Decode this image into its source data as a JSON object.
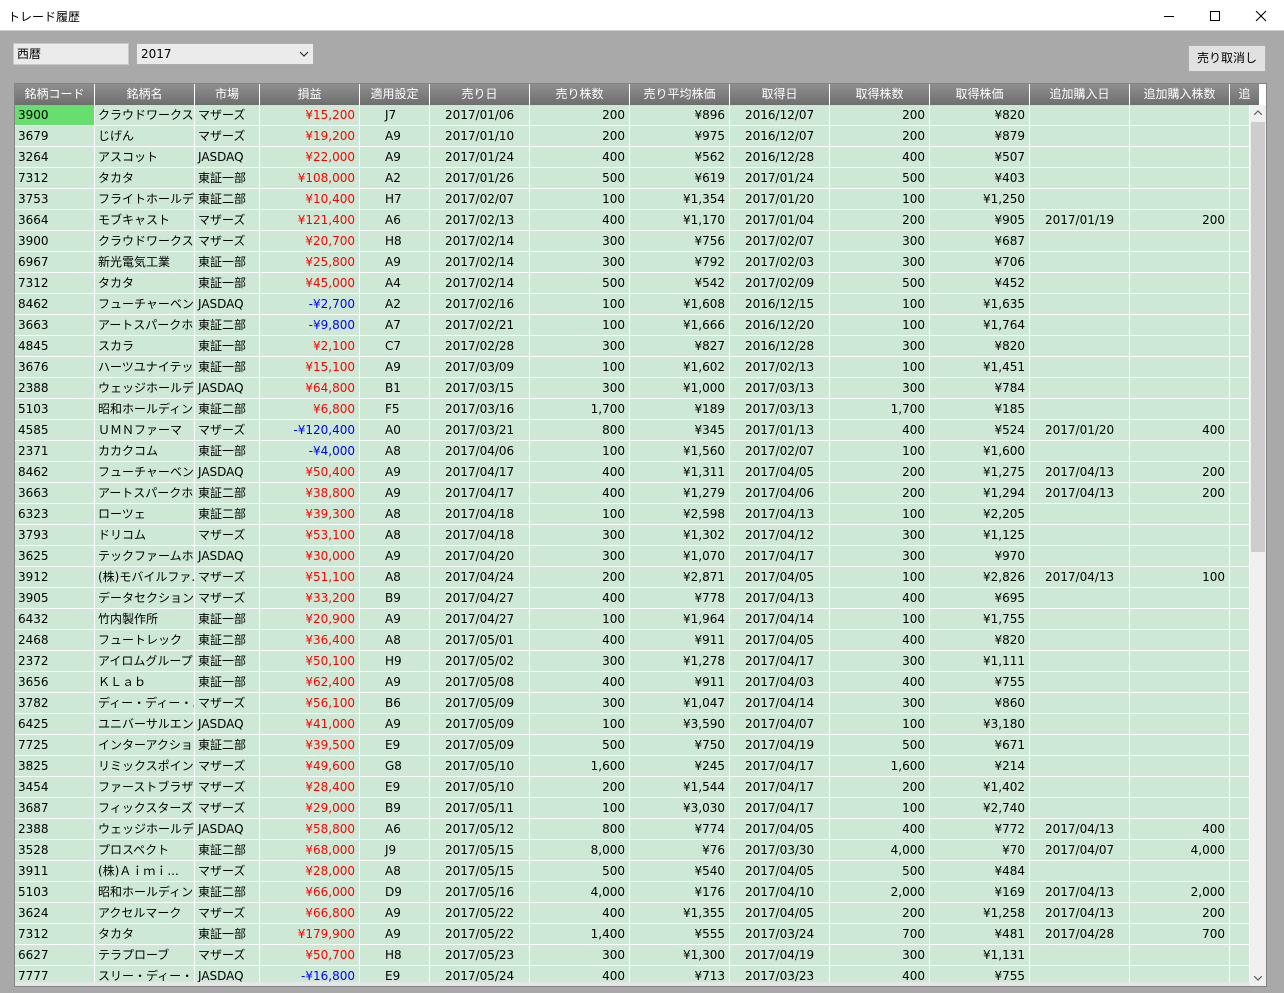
{
  "window": {
    "title": "トレード履歴"
  },
  "toolbar": {
    "era_label": "西暦",
    "year_value": "2017",
    "cancel_sell_label": "売り取消し"
  },
  "columns": [
    "銘柄コード",
    "銘柄名",
    "市場",
    "損益",
    "適用設定",
    "売り日",
    "売り株数",
    "売り平均株価",
    "取得日",
    "取得株数",
    "取得株価",
    "追加購入日",
    "追加購入株数",
    "追"
  ],
  "rows": [
    {
      "code": "3900",
      "name": "クラウドワークス",
      "market": "マザーズ",
      "pl": "¥15,200",
      "setting": "J7",
      "sell_date": "2017/01/06",
      "sell_qty": "200",
      "sell_avg": "¥896",
      "buy_date": "2016/12/07",
      "buy_qty": "200",
      "buy_price": "¥820",
      "add_date": "",
      "add_qty": ""
    },
    {
      "code": "3679",
      "name": "じげん",
      "market": "マザーズ",
      "pl": "¥19,200",
      "setting": "A9",
      "sell_date": "2017/01/10",
      "sell_qty": "200",
      "sell_avg": "¥975",
      "buy_date": "2016/12/07",
      "buy_qty": "200",
      "buy_price": "¥879",
      "add_date": "",
      "add_qty": ""
    },
    {
      "code": "3264",
      "name": "アスコット",
      "market": "JASDAQ",
      "pl": "¥22,000",
      "setting": "A9",
      "sell_date": "2017/01/24",
      "sell_qty": "400",
      "sell_avg": "¥562",
      "buy_date": "2016/12/28",
      "buy_qty": "400",
      "buy_price": "¥507",
      "add_date": "",
      "add_qty": ""
    },
    {
      "code": "7312",
      "name": "タカタ",
      "market": "東証一部",
      "pl": "¥108,000",
      "setting": "A2",
      "sell_date": "2017/01/26",
      "sell_qty": "500",
      "sell_avg": "¥619",
      "buy_date": "2017/01/24",
      "buy_qty": "500",
      "buy_price": "¥403",
      "add_date": "",
      "add_qty": ""
    },
    {
      "code": "3753",
      "name": "フライトホールディ...",
      "market": "東証二部",
      "pl": "¥10,400",
      "setting": "H7",
      "sell_date": "2017/02/07",
      "sell_qty": "100",
      "sell_avg": "¥1,354",
      "buy_date": "2017/01/20",
      "buy_qty": "100",
      "buy_price": "¥1,250",
      "add_date": "",
      "add_qty": ""
    },
    {
      "code": "3664",
      "name": "モブキャスト",
      "market": "マザーズ",
      "pl": "¥121,400",
      "setting": "A6",
      "sell_date": "2017/02/13",
      "sell_qty": "400",
      "sell_avg": "¥1,170",
      "buy_date": "2017/01/04",
      "buy_qty": "200",
      "buy_price": "¥905",
      "add_date": "2017/01/19",
      "add_qty": "200"
    },
    {
      "code": "3900",
      "name": "クラウドワークス",
      "market": "マザーズ",
      "pl": "¥20,700",
      "setting": "H8",
      "sell_date": "2017/02/14",
      "sell_qty": "300",
      "sell_avg": "¥756",
      "buy_date": "2017/02/07",
      "buy_qty": "300",
      "buy_price": "¥687",
      "add_date": "",
      "add_qty": ""
    },
    {
      "code": "6967",
      "name": "新光電気工業",
      "market": "東証一部",
      "pl": "¥25,800",
      "setting": "A9",
      "sell_date": "2017/02/14",
      "sell_qty": "300",
      "sell_avg": "¥792",
      "buy_date": "2017/02/03",
      "buy_qty": "300",
      "buy_price": "¥706",
      "add_date": "",
      "add_qty": ""
    },
    {
      "code": "7312",
      "name": "タカタ",
      "market": "東証一部",
      "pl": "¥45,000",
      "setting": "A4",
      "sell_date": "2017/02/14",
      "sell_qty": "500",
      "sell_avg": "¥542",
      "buy_date": "2017/02/09",
      "buy_qty": "500",
      "buy_price": "¥452",
      "add_date": "",
      "add_qty": ""
    },
    {
      "code": "8462",
      "name": "フューチャーベンチ...",
      "market": "JASDAQ",
      "pl": "-¥2,700",
      "setting": "A2",
      "sell_date": "2017/02/16",
      "sell_qty": "100",
      "sell_avg": "¥1,608",
      "buy_date": "2016/12/15",
      "buy_qty": "100",
      "buy_price": "¥1,635",
      "add_date": "",
      "add_qty": ""
    },
    {
      "code": "3663",
      "name": "アートスパークホ...",
      "market": "東証二部",
      "pl": "-¥9,800",
      "setting": "A7",
      "sell_date": "2017/02/21",
      "sell_qty": "100",
      "sell_avg": "¥1,666",
      "buy_date": "2016/12/20",
      "buy_qty": "100",
      "buy_price": "¥1,764",
      "add_date": "",
      "add_qty": ""
    },
    {
      "code": "4845",
      "name": "スカラ",
      "market": "東証一部",
      "pl": "¥2,100",
      "setting": "C7",
      "sell_date": "2017/02/28",
      "sell_qty": "300",
      "sell_avg": "¥827",
      "buy_date": "2016/12/28",
      "buy_qty": "300",
      "buy_price": "¥820",
      "add_date": "",
      "add_qty": ""
    },
    {
      "code": "3676",
      "name": "ハーツユナイテッ...",
      "market": "東証一部",
      "pl": "¥15,100",
      "setting": "A9",
      "sell_date": "2017/03/09",
      "sell_qty": "100",
      "sell_avg": "¥1,602",
      "buy_date": "2017/02/13",
      "buy_qty": "100",
      "buy_price": "¥1,451",
      "add_date": "",
      "add_qty": ""
    },
    {
      "code": "2388",
      "name": "ウェッジホールディ...",
      "market": "JASDAQ",
      "pl": "¥64,800",
      "setting": "B1",
      "sell_date": "2017/03/15",
      "sell_qty": "300",
      "sell_avg": "¥1,000",
      "buy_date": "2017/03/13",
      "buy_qty": "300",
      "buy_price": "¥784",
      "add_date": "",
      "add_qty": ""
    },
    {
      "code": "5103",
      "name": "昭和ホールディン...",
      "market": "東証二部",
      "pl": "¥6,800",
      "setting": "F5",
      "sell_date": "2017/03/16",
      "sell_qty": "1,700",
      "sell_avg": "¥189",
      "buy_date": "2017/03/13",
      "buy_qty": "1,700",
      "buy_price": "¥185",
      "add_date": "",
      "add_qty": ""
    },
    {
      "code": "4585",
      "name": "ＵＭＮファーマ",
      "market": "マザーズ",
      "pl": "-¥120,400",
      "setting": "A0",
      "sell_date": "2017/03/21",
      "sell_qty": "800",
      "sell_avg": "¥345",
      "buy_date": "2017/01/13",
      "buy_qty": "400",
      "buy_price": "¥524",
      "add_date": "2017/01/20",
      "add_qty": "400"
    },
    {
      "code": "2371",
      "name": "カカクコム",
      "market": "東証一部",
      "pl": "-¥4,000",
      "setting": "A8",
      "sell_date": "2017/04/06",
      "sell_qty": "100",
      "sell_avg": "¥1,560",
      "buy_date": "2017/02/07",
      "buy_qty": "100",
      "buy_price": "¥1,600",
      "add_date": "",
      "add_qty": ""
    },
    {
      "code": "8462",
      "name": "フューチャーベンチ...",
      "market": "JASDAQ",
      "pl": "¥50,400",
      "setting": "A9",
      "sell_date": "2017/04/17",
      "sell_qty": "400",
      "sell_avg": "¥1,311",
      "buy_date": "2017/04/05",
      "buy_qty": "200",
      "buy_price": "¥1,275",
      "add_date": "2017/04/13",
      "add_qty": "200"
    },
    {
      "code": "3663",
      "name": "アートスパークホ...",
      "market": "東証二部",
      "pl": "¥38,800",
      "setting": "A9",
      "sell_date": "2017/04/17",
      "sell_qty": "400",
      "sell_avg": "¥1,279",
      "buy_date": "2017/04/06",
      "buy_qty": "200",
      "buy_price": "¥1,294",
      "add_date": "2017/04/13",
      "add_qty": "200"
    },
    {
      "code": "6323",
      "name": "ローツェ",
      "market": "東証二部",
      "pl": "¥39,300",
      "setting": "A8",
      "sell_date": "2017/04/18",
      "sell_qty": "100",
      "sell_avg": "¥2,598",
      "buy_date": "2017/04/13",
      "buy_qty": "100",
      "buy_price": "¥2,205",
      "add_date": "",
      "add_qty": ""
    },
    {
      "code": "3793",
      "name": "ドリコム",
      "market": "マザーズ",
      "pl": "¥53,100",
      "setting": "A8",
      "sell_date": "2017/04/18",
      "sell_qty": "300",
      "sell_avg": "¥1,302",
      "buy_date": "2017/04/12",
      "buy_qty": "300",
      "buy_price": "¥1,125",
      "add_date": "",
      "add_qty": ""
    },
    {
      "code": "3625",
      "name": "テックファームホー...",
      "market": "JASDAQ",
      "pl": "¥30,000",
      "setting": "A9",
      "sell_date": "2017/04/20",
      "sell_qty": "300",
      "sell_avg": "¥1,070",
      "buy_date": "2017/04/17",
      "buy_qty": "300",
      "buy_price": "¥970",
      "add_date": "",
      "add_qty": ""
    },
    {
      "code": "3912",
      "name": "(株)モバイルファ...",
      "market": "マザーズ",
      "pl": "¥51,100",
      "setting": "A8",
      "sell_date": "2017/04/24",
      "sell_qty": "200",
      "sell_avg": "¥2,871",
      "buy_date": "2017/04/05",
      "buy_qty": "100",
      "buy_price": "¥2,826",
      "add_date": "2017/04/13",
      "add_qty": "100"
    },
    {
      "code": "3905",
      "name": "データセクション",
      "market": "マザーズ",
      "pl": "¥33,200",
      "setting": "B9",
      "sell_date": "2017/04/27",
      "sell_qty": "400",
      "sell_avg": "¥778",
      "buy_date": "2017/04/13",
      "buy_qty": "400",
      "buy_price": "¥695",
      "add_date": "",
      "add_qty": ""
    },
    {
      "code": "6432",
      "name": "竹内製作所",
      "market": "東証一部",
      "pl": "¥20,900",
      "setting": "A9",
      "sell_date": "2017/04/27",
      "sell_qty": "100",
      "sell_avg": "¥1,964",
      "buy_date": "2017/04/14",
      "buy_qty": "100",
      "buy_price": "¥1,755",
      "add_date": "",
      "add_qty": ""
    },
    {
      "code": "2468",
      "name": "フュートレック",
      "market": "東証二部",
      "pl": "¥36,400",
      "setting": "A8",
      "sell_date": "2017/05/01",
      "sell_qty": "400",
      "sell_avg": "¥911",
      "buy_date": "2017/04/05",
      "buy_qty": "400",
      "buy_price": "¥820",
      "add_date": "",
      "add_qty": ""
    },
    {
      "code": "2372",
      "name": "アイロムグループ",
      "market": "東証一部",
      "pl": "¥50,100",
      "setting": "H9",
      "sell_date": "2017/05/02",
      "sell_qty": "300",
      "sell_avg": "¥1,278",
      "buy_date": "2017/04/17",
      "buy_qty": "300",
      "buy_price": "¥1,111",
      "add_date": "",
      "add_qty": ""
    },
    {
      "code": "3656",
      "name": "ＫＬａｂ",
      "market": "東証一部",
      "pl": "¥62,400",
      "setting": "A9",
      "sell_date": "2017/05/08",
      "sell_qty": "400",
      "sell_avg": "¥911",
      "buy_date": "2017/04/03",
      "buy_qty": "400",
      "buy_price": "¥755",
      "add_date": "",
      "add_qty": ""
    },
    {
      "code": "3782",
      "name": "ディー・ディー・エス",
      "market": "マザーズ",
      "pl": "¥56,100",
      "setting": "B6",
      "sell_date": "2017/05/09",
      "sell_qty": "300",
      "sell_avg": "¥1,047",
      "buy_date": "2017/04/14",
      "buy_qty": "300",
      "buy_price": "¥860",
      "add_date": "",
      "add_qty": ""
    },
    {
      "code": "6425",
      "name": "ユニバーサルエン...",
      "market": "JASDAQ",
      "pl": "¥41,000",
      "setting": "A9",
      "sell_date": "2017/05/09",
      "sell_qty": "100",
      "sell_avg": "¥3,590",
      "buy_date": "2017/04/07",
      "buy_qty": "100",
      "buy_price": "¥3,180",
      "add_date": "",
      "add_qty": ""
    },
    {
      "code": "7725",
      "name": "インターアクション",
      "market": "東証二部",
      "pl": "¥39,500",
      "setting": "E9",
      "sell_date": "2017/05/09",
      "sell_qty": "500",
      "sell_avg": "¥750",
      "buy_date": "2017/04/19",
      "buy_qty": "500",
      "buy_price": "¥671",
      "add_date": "",
      "add_qty": ""
    },
    {
      "code": "3825",
      "name": "リミックスポイント",
      "market": "マザーズ",
      "pl": "¥49,600",
      "setting": "G8",
      "sell_date": "2017/05/10",
      "sell_qty": "1,600",
      "sell_avg": "¥245",
      "buy_date": "2017/04/17",
      "buy_qty": "1,600",
      "buy_price": "¥214",
      "add_date": "",
      "add_qty": ""
    },
    {
      "code": "3454",
      "name": "ファーストブラザーズ",
      "market": "マザーズ",
      "pl": "¥28,400",
      "setting": "E9",
      "sell_date": "2017/05/10",
      "sell_qty": "200",
      "sell_avg": "¥1,544",
      "buy_date": "2017/04/17",
      "buy_qty": "200",
      "buy_price": "¥1,402",
      "add_date": "",
      "add_qty": ""
    },
    {
      "code": "3687",
      "name": "フィックスターズ",
      "market": "マザーズ",
      "pl": "¥29,000",
      "setting": "B9",
      "sell_date": "2017/05/11",
      "sell_qty": "100",
      "sell_avg": "¥3,030",
      "buy_date": "2017/04/17",
      "buy_qty": "100",
      "buy_price": "¥2,740",
      "add_date": "",
      "add_qty": ""
    },
    {
      "code": "2388",
      "name": "ウェッジホールディ...",
      "market": "JASDAQ",
      "pl": "¥58,800",
      "setting": "A6",
      "sell_date": "2017/05/12",
      "sell_qty": "800",
      "sell_avg": "¥774",
      "buy_date": "2017/04/05",
      "buy_qty": "400",
      "buy_price": "¥772",
      "add_date": "2017/04/13",
      "add_qty": "400"
    },
    {
      "code": "3528",
      "name": "プロスペクト",
      "market": "東証二部",
      "pl": "¥68,000",
      "setting": "J9",
      "sell_date": "2017/05/15",
      "sell_qty": "8,000",
      "sell_avg": "¥76",
      "buy_date": "2017/03/30",
      "buy_qty": "4,000",
      "buy_price": "¥70",
      "add_date": "2017/04/07",
      "add_qty": "4,000"
    },
    {
      "code": "3911",
      "name": "(株)Ａｉｍｉ...",
      "market": "マザーズ",
      "pl": "¥28,000",
      "setting": "A8",
      "sell_date": "2017/05/15",
      "sell_qty": "500",
      "sell_avg": "¥540",
      "buy_date": "2017/04/05",
      "buy_qty": "500",
      "buy_price": "¥484",
      "add_date": "",
      "add_qty": ""
    },
    {
      "code": "5103",
      "name": "昭和ホールディン...",
      "market": "東証二部",
      "pl": "¥66,000",
      "setting": "D9",
      "sell_date": "2017/05/16",
      "sell_qty": "4,000",
      "sell_avg": "¥176",
      "buy_date": "2017/04/10",
      "buy_qty": "2,000",
      "buy_price": "¥169",
      "add_date": "2017/04/13",
      "add_qty": "2,000"
    },
    {
      "code": "3624",
      "name": "アクセルマーク",
      "market": "マザーズ",
      "pl": "¥66,800",
      "setting": "A9",
      "sell_date": "2017/05/22",
      "sell_qty": "400",
      "sell_avg": "¥1,355",
      "buy_date": "2017/04/05",
      "buy_qty": "200",
      "buy_price": "¥1,258",
      "add_date": "2017/04/13",
      "add_qty": "200"
    },
    {
      "code": "7312",
      "name": "タカタ",
      "market": "東証一部",
      "pl": "¥179,900",
      "setting": "A9",
      "sell_date": "2017/05/22",
      "sell_qty": "1,400",
      "sell_avg": "¥555",
      "buy_date": "2017/03/24",
      "buy_qty": "700",
      "buy_price": "¥481",
      "add_date": "2017/04/28",
      "add_qty": "700"
    },
    {
      "code": "6627",
      "name": "テラプローブ",
      "market": "マザーズ",
      "pl": "¥50,700",
      "setting": "H8",
      "sell_date": "2017/05/23",
      "sell_qty": "300",
      "sell_avg": "¥1,300",
      "buy_date": "2017/04/19",
      "buy_qty": "300",
      "buy_price": "¥1,131",
      "add_date": "",
      "add_qty": ""
    },
    {
      "code": "7777",
      "name": "スリー・ディー・マ...",
      "market": "JASDAQ",
      "pl": "-¥16,800",
      "setting": "E9",
      "sell_date": "2017/05/24",
      "sell_qty": "400",
      "sell_avg": "¥713",
      "buy_date": "2017/03/23",
      "buy_qty": "400",
      "buy_price": "¥755",
      "add_date": "",
      "add_qty": ""
    }
  ]
}
